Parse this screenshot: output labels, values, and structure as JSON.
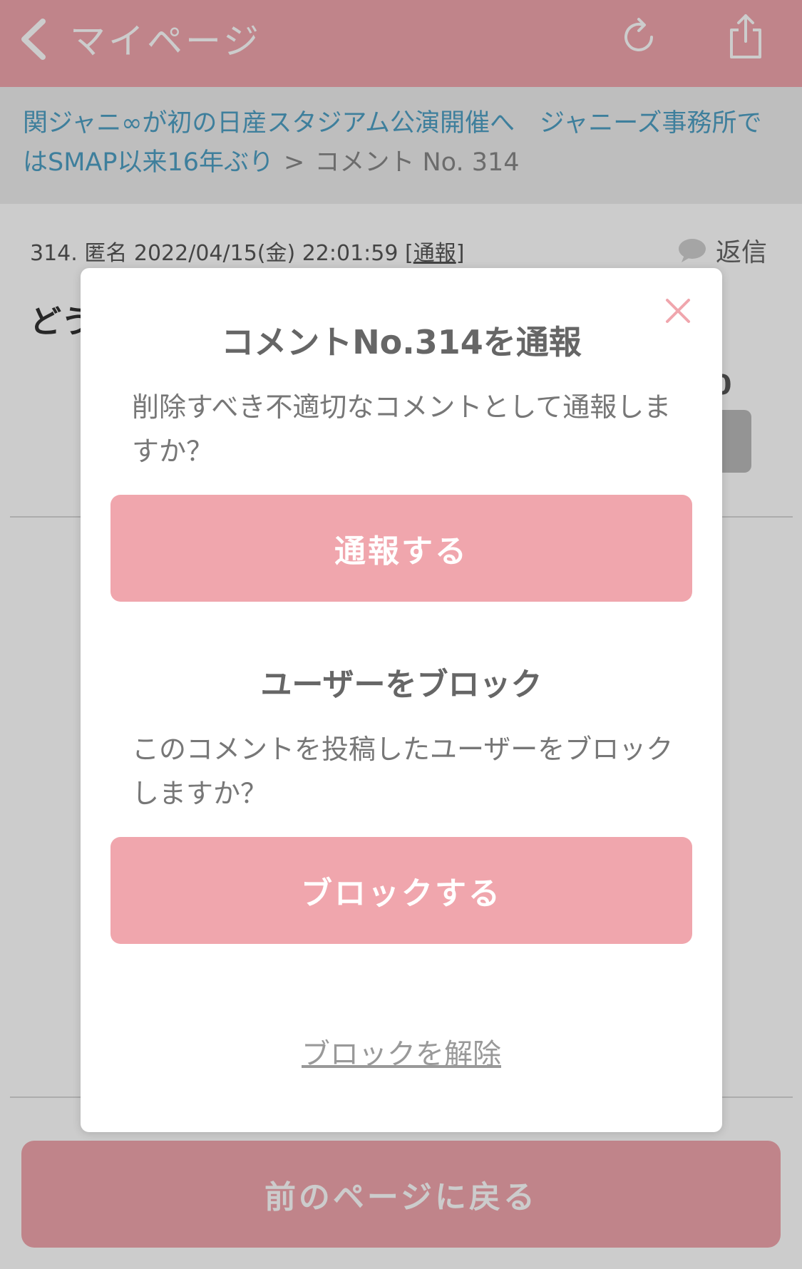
{
  "header": {
    "title": "マイページ",
    "bg_color": "#f0a6ad"
  },
  "breadcrumb": {
    "link_text": "関ジャニ∞が初の日産スタジアム公演開催へ　ジャニーズ事務所ではSMAP以来16年ぶり",
    "separator": ">",
    "current": "コメント No. 314",
    "link_color": "#4e9fc4"
  },
  "comment": {
    "meta_prefix": "314. 匿名 2022/04/15(金) 22:01:59 [",
    "report_label": "通報",
    "meta_suffix": "]",
    "reply_label": "返信",
    "body_visible": "どう",
    "vote_count_visible": "0"
  },
  "modal": {
    "title": "コメントNo.314を通報",
    "report_desc": "削除すべき不適切なコメントとして通報しますか？",
    "report_button": "通報する",
    "block_title": "ユーザーをブロック",
    "block_desc": "このコメントを投稿したユーザーをブロックしますか？",
    "block_button": "ブロックする",
    "unblock_link": "ブロックを解除"
  },
  "footer": {
    "back_button": "前のページに戻る"
  },
  "icons": {
    "back": "chevron-left-icon",
    "reload": "reload-icon",
    "share": "share-icon",
    "reply": "speech-bubble-icon",
    "close": "close-icon"
  }
}
